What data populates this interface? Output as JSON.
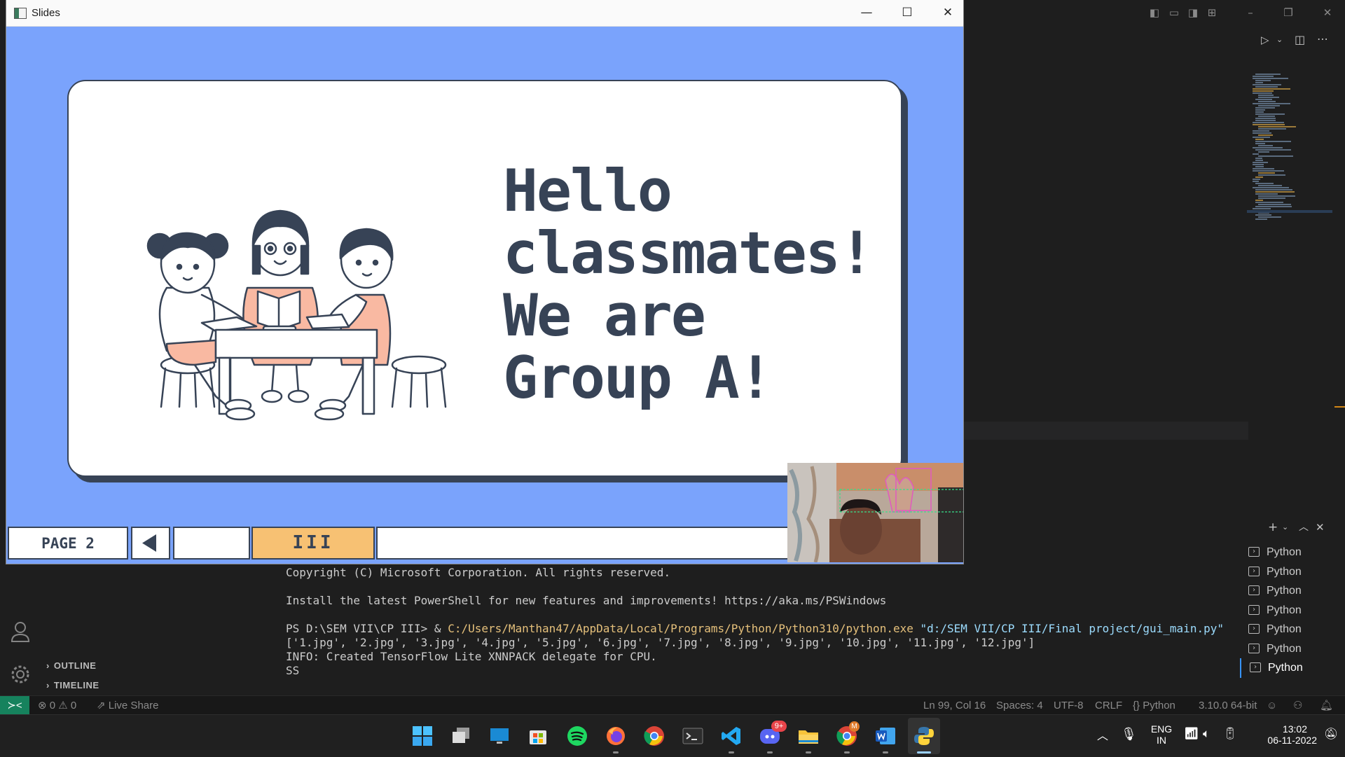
{
  "slides_window": {
    "title": "Slides",
    "slide_text": "Hello\nclassmates!\nWe are\nGroup A!",
    "page_label": "PAGE 2",
    "pause_label": "III"
  },
  "terminal": {
    "line1": "Copyright (C) Microsoft Corporation. All rights reserved.",
    "line2": "Install the latest PowerShell for new features and improvements! https://aka.ms/PSWindows",
    "prompt": "PS D:\\SEM VII\\CP III> & ",
    "exe_path": "C:/Users/Manthan47/AppData/Local/Programs/Python/Python310/python.exe",
    "script_path": "\"d:/SEM VII/CP III/Final project/gui_main.py\"",
    "line4": "['1.jpg', '2.jpg', '3.jpg', '4.jpg', '5.jpg', '6.jpg', '7.jpg', '8.jpg', '9.jpg', '10.jpg', '11.jpg', '12.jpg']",
    "line5": "INFO: Created TensorFlow Lite XNNPACK delegate for CPU.",
    "line6": "SS"
  },
  "terminal_list": [
    "Python",
    "Python",
    "Python",
    "Python",
    "Python",
    "Python",
    "Python"
  ],
  "sidebar": {
    "outline": "OUTLINE",
    "timeline": "TIMELINE"
  },
  "statusbar": {
    "errors": "0",
    "warnings": "0",
    "live_share": "Live Share",
    "position": "Ln 99, Col 16",
    "spaces": "Spaces: 4",
    "encoding": "UTF-8",
    "eol": "CRLF",
    "language": "Python",
    "interpreter": "3.10.0 64-bit"
  },
  "taskbar": {
    "discord_badge": "9+",
    "chrome_badge": "M",
    "lang_top": "ENG",
    "lang_bottom": "IN",
    "time": "13:02",
    "date": "06-11-2022"
  }
}
